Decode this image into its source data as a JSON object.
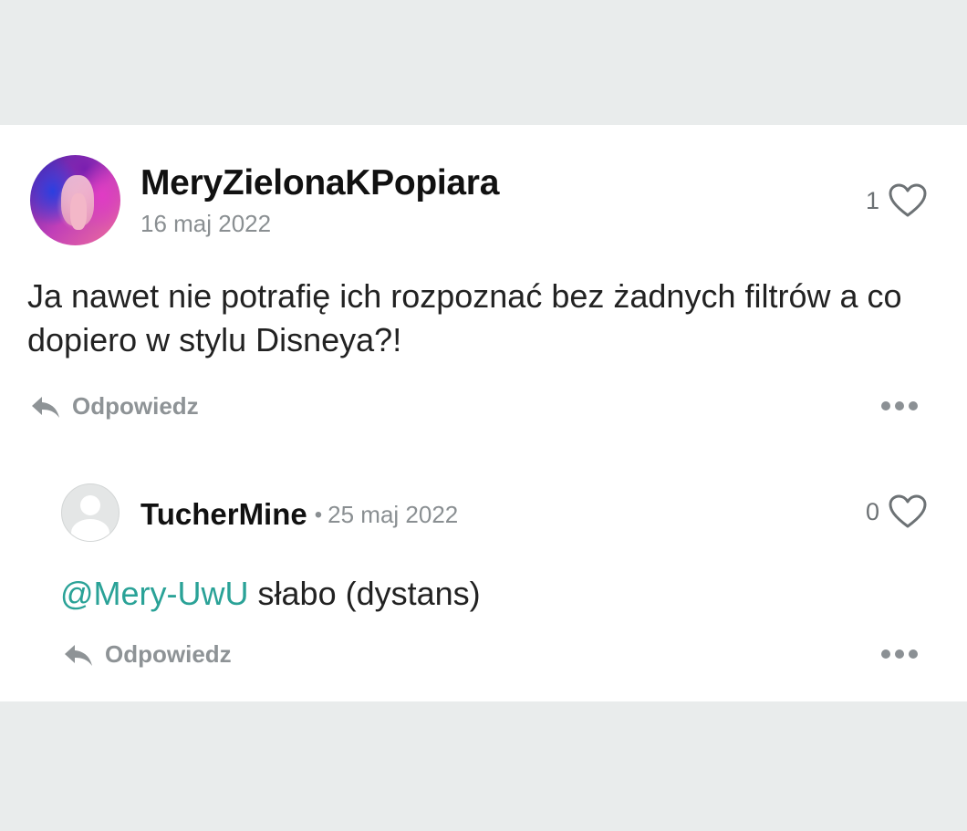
{
  "comments": [
    {
      "username": "MeryZielonaKPopiara",
      "date": "16 maj 2022",
      "likes": "1",
      "text": "Ja nawet nie potrafię ich rozpoznać bez żadnych filtrów a co dopiero w stylu Disneya?!",
      "reply_label": "Odpowiedz",
      "avatar_icon": "profile-photo"
    },
    {
      "username": "TucherMine",
      "separator": "•",
      "date": "25 maj 2022",
      "likes": "0",
      "mention": "@Mery-UwU",
      "text": " słabo (dystans)",
      "reply_label": "Odpowiedz",
      "avatar_icon": "default-user-icon"
    }
  ],
  "icons": {
    "like": "heart-icon",
    "reply": "reply-arrow-icon",
    "more": "more-options-icon"
  },
  "colors": {
    "background": "#e9ecec",
    "card": "#ffffff",
    "mention": "#2aa297",
    "muted": "#8a8f92"
  }
}
